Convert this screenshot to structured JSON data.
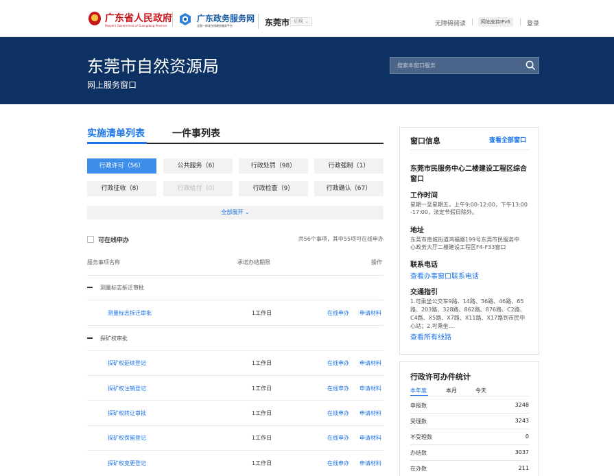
{
  "header": {
    "gov_title": "广东省人民政府",
    "gov_subtitle": "People's Government of Guangdong Province",
    "service_title": "广东政务服务网",
    "service_subtitle": "全国一体化在线政务服务平台",
    "city": "东莞市",
    "switch_label": "切换",
    "accessibility": "无障碍阅读",
    "ipv6": "网站支持IPv6",
    "login": "登录"
  },
  "banner": {
    "title": "东莞市自然资源局",
    "subtitle": "网上服务窗口",
    "search_placeholder": "搜索本窗口服务"
  },
  "tabs": [
    {
      "label": "实施清单列表",
      "active": true
    },
    {
      "label": "一件事列表",
      "active": false
    }
  ],
  "categories": [
    {
      "label": "行政许可（56）",
      "state": "active"
    },
    {
      "label": "公共服务（6）",
      "state": "normal"
    },
    {
      "label": "行政处罚（98）",
      "state": "normal"
    },
    {
      "label": "行政强制（1）",
      "state": "normal"
    },
    {
      "label": "行政征收（8）",
      "state": "normal"
    },
    {
      "label": "行政给付（0）",
      "state": "disabled"
    },
    {
      "label": "行政检查（9）",
      "state": "normal"
    },
    {
      "label": "行政确认（67）",
      "state": "normal"
    }
  ],
  "expand_all": "全部展开",
  "filter": {
    "online_label": "可在线申办",
    "summary": "共56个事项，其中55项可在线申办"
  },
  "table": {
    "col_name": "服务事项名称",
    "col_deadline": "承诺办结期限",
    "col_action": "操作"
  },
  "groups": [
    {
      "label": "测量标志拆迁审批",
      "items": [
        {
          "name": "测量标志拆迁审批",
          "days": "1工作日",
          "online": "在线申办",
          "materials": "申请材料"
        }
      ]
    },
    {
      "label": "探矿权审批",
      "items": [
        {
          "name": "探矿权延续登记",
          "days": "1工作日",
          "online": "在线申办",
          "materials": "申请材料"
        },
        {
          "name": "探矿权注销登记",
          "days": "1工作日",
          "online": "在线申办",
          "materials": "申请材料"
        },
        {
          "name": "探矿权转让审批",
          "days": "1工作日",
          "online": "在线申办",
          "materials": "申请材料"
        },
        {
          "name": "探矿权保留登记",
          "days": "1工作日",
          "online": "在线申办",
          "materials": "申请材料"
        },
        {
          "name": "探矿权变更登记",
          "days": "1工作日",
          "online": "在线申办",
          "materials": "申请材料"
        }
      ]
    }
  ],
  "window_info": {
    "title": "窗口信息",
    "view_all": "查看全部窗口",
    "location_line1": "东莞市民服务中心二楼建设工程区综合",
    "location_line2": "窗口",
    "hours_title": "工作时间",
    "hours_line1": "星期一至星期五，上午9:00-12:00，下午13:00",
    "hours_line2": "-17:00，法定节假日除外。",
    "address_title": "地址",
    "address_line1": "东莞市南城街道鸿福路199号东莞市民服务中",
    "address_line2": "心政务大厅二楼建设工程区F4-F33窗口",
    "phone_title": "联系电话",
    "phone_link": "查看办事窗口联系电话",
    "traffic_title": "交通指引",
    "traffic_line1": "1.可乘坐公交车9路、14路、36路、46路、65",
    "traffic_line2": "路、203路、328路、862路、876路、C2路、",
    "traffic_line3": "C4路、X5路、X7路、X11路、X17路到市民中",
    "traffic_line4": "心站；2.可乘坐...",
    "traffic_link": "查看所有线路"
  },
  "stats": {
    "title": "行政许可办件统计",
    "tabs": [
      "本年度",
      "本月",
      "今天"
    ],
    "rows": [
      {
        "label": "申报数",
        "value": "3248"
      },
      {
        "label": "受理数",
        "value": "3243"
      },
      {
        "label": "不受理数",
        "value": "0"
      },
      {
        "label": "办结数",
        "value": "3037"
      },
      {
        "label": "在办数",
        "value": "211"
      }
    ]
  },
  "colors": {
    "banner": "#0e3163",
    "accent": "#1a73e8",
    "gov_red": "#c8161d"
  }
}
